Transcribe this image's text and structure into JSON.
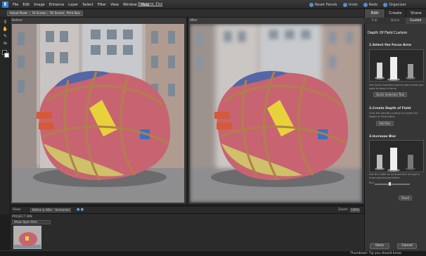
{
  "app": {
    "logo": "E",
    "file_tab": "Welcome_Kiss"
  },
  "menu": [
    "File",
    "Edit",
    "Image",
    "Enhance",
    "Layer",
    "Select",
    "Filter",
    "View",
    "Window",
    "Help"
  ],
  "actions": [
    {
      "label": "Reset Panels",
      "icon": "reset-icon"
    },
    {
      "label": "Undo",
      "icon": "undo-icon"
    },
    {
      "label": "Redo",
      "icon": "redo-icon"
    },
    {
      "label": "Organizer",
      "icon": "organizer-icon"
    }
  ],
  "modes": [
    "Edit",
    "Create",
    "Share"
  ],
  "subtabs": [
    "Full",
    "Quick",
    "Guided"
  ],
  "view_buttons": [
    "Actual Pixels",
    "Fit Screen",
    "Fill Screen",
    "Print Size"
  ],
  "panes": {
    "before": "Before",
    "after": "After"
  },
  "viewbar": {
    "view_label": "View:",
    "view_value": "Before & After - Horizontal",
    "zoom_label": "Zoom:",
    "zoom_value": "100%"
  },
  "bin": {
    "title": "PROJECT BIN",
    "select": "Show Open Files"
  },
  "panel": {
    "title": "Depth Of Field Custom",
    "step1": "1.Select the Focus Area",
    "step1_text": "Use Quick Selection tool to mark areas you want to keep in focus.",
    "step1_tool": "Quick Selection Tool",
    "step2": "2.Create Depth of Field",
    "step2_text": "Click the Add Blur button to create the Depth of Field effect.",
    "step2_btn": "Add Blur",
    "step3": "3.Increase Blur",
    "step3_text": "Use the slider to increase blur and get a more pronounced effect.",
    "blur_label": "Blur",
    "blur_level": 0.42,
    "reset_btn": "Reset",
    "done": "Done",
    "cancel": "Cancel"
  },
  "status": {
    "tip": "Thumbnail: Tip you should know"
  }
}
